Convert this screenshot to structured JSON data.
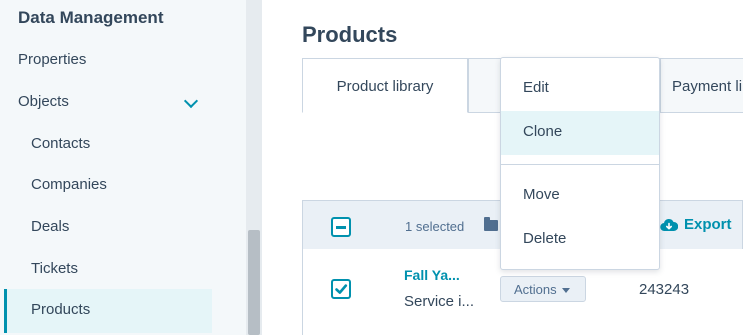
{
  "sidebar": {
    "heading": "Data Management",
    "items": [
      {
        "label": "Properties"
      },
      {
        "label": "Objects"
      },
      {
        "label": "Contacts"
      },
      {
        "label": "Companies"
      },
      {
        "label": "Deals"
      },
      {
        "label": "Tickets"
      },
      {
        "label": "Products"
      }
    ]
  },
  "main": {
    "title": "Products",
    "tabs": [
      {
        "label": "Product library"
      },
      {
        "label": "Payment li"
      }
    ],
    "toolbar": {
      "selected_text": "1 selected",
      "export_label": "Export"
    },
    "row": {
      "name": "Fall Ya...",
      "description": "Service i...",
      "actions_label": "Actions",
      "id": "243243"
    }
  },
  "dropdown": {
    "items": [
      {
        "label": "Edit"
      },
      {
        "label": "Clone"
      },
      {
        "label": "Move"
      },
      {
        "label": "Delete"
      }
    ]
  },
  "colors": {
    "accent": "#0091ae",
    "text": "#33475b",
    "sidebar_bg": "#f4f8fa",
    "highlight": "#e5f5f8",
    "border": "#cbd6e2"
  },
  "icons": [
    "chevron-down-icon",
    "folder-icon",
    "cloud-download-icon",
    "checkbox-checked-icon",
    "checkbox-indeterminate-icon",
    "caret-down-icon"
  ]
}
